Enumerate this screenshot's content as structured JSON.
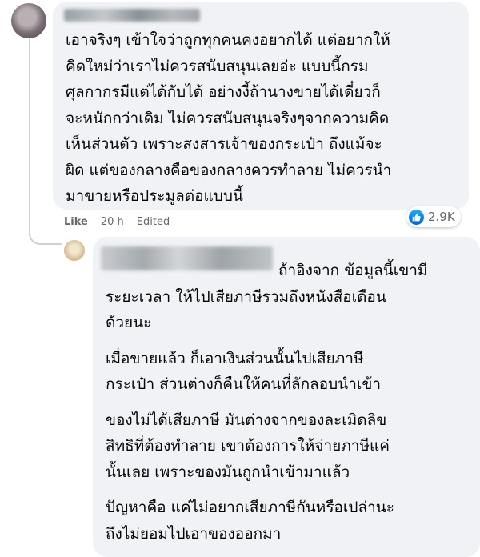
{
  "comment1": {
    "author": "",
    "lines": [
      "เอาจริงๆ เข้าใจว่าถูกทุกคนคงอยากได้ แต่อยากให้",
      "คิดใหม่ว่าเราไม่ควรสนับสนุนเลยอ่ะ แบบนี้กรม",
      "ศุลกากรมีแต่ได้กับได้ อย่างงี้ถ้านางขายได้เดี๋ยวก็",
      "จะหนักกว่าเดิม ไม่ควรสนับสนุนจริงๆจากความคิด",
      "เห็นส่วนตัว เพราะสงสารเจ้าของกระเป๋า ถึงแม้จะ",
      "ผิด แต่ของกลางคือของกลางควรทำลาย ไม่ควรนำ",
      "มาขายหรือประมูลต่อแบบนี้"
    ],
    "meta": {
      "like": "Like",
      "time": "20 h",
      "edited": "Edited"
    },
    "reactions": {
      "icon": "like-icon",
      "count": "2.9K"
    }
  },
  "comment2": {
    "author": "",
    "paragraphs": [
      [
        "ถ้าอิงจาก ข้อมูลนี้เขามี",
        "ระยะเวลา ให้ไปเสียภาษีรวมถึงหนังสือเดือน",
        "ด้วยนะ"
      ],
      [
        "เมื่อขายแล้ว ก็เอาเงินส่วนนั้นไปเสียภาษี",
        "กระเป๋า ส่วนต่างก็คืนให้คนที่ลักลอบนำเข้า"
      ],
      [
        "ของไม่ได้เสียภาษี มันต่างจากของละเมิดลิข",
        "สิทธิที่ต้องทำลาย เขาต้องการให้จ่ายภาษีแค่",
        "นั้นเลย เพราะของมันถูกนำเข้ามาแล้ว"
      ],
      [
        "ปัญหาคือ แค่ไม่อยากเสียภาษีกันหรือเปล่านะ",
        "ถึงไม่ยอมไปเอาของออกมา"
      ]
    ]
  },
  "colors": {
    "bubble": "#f0f2f5",
    "meta": "#65676b",
    "like_blue": "#1877f2",
    "thread_line": "#ced0d4"
  }
}
